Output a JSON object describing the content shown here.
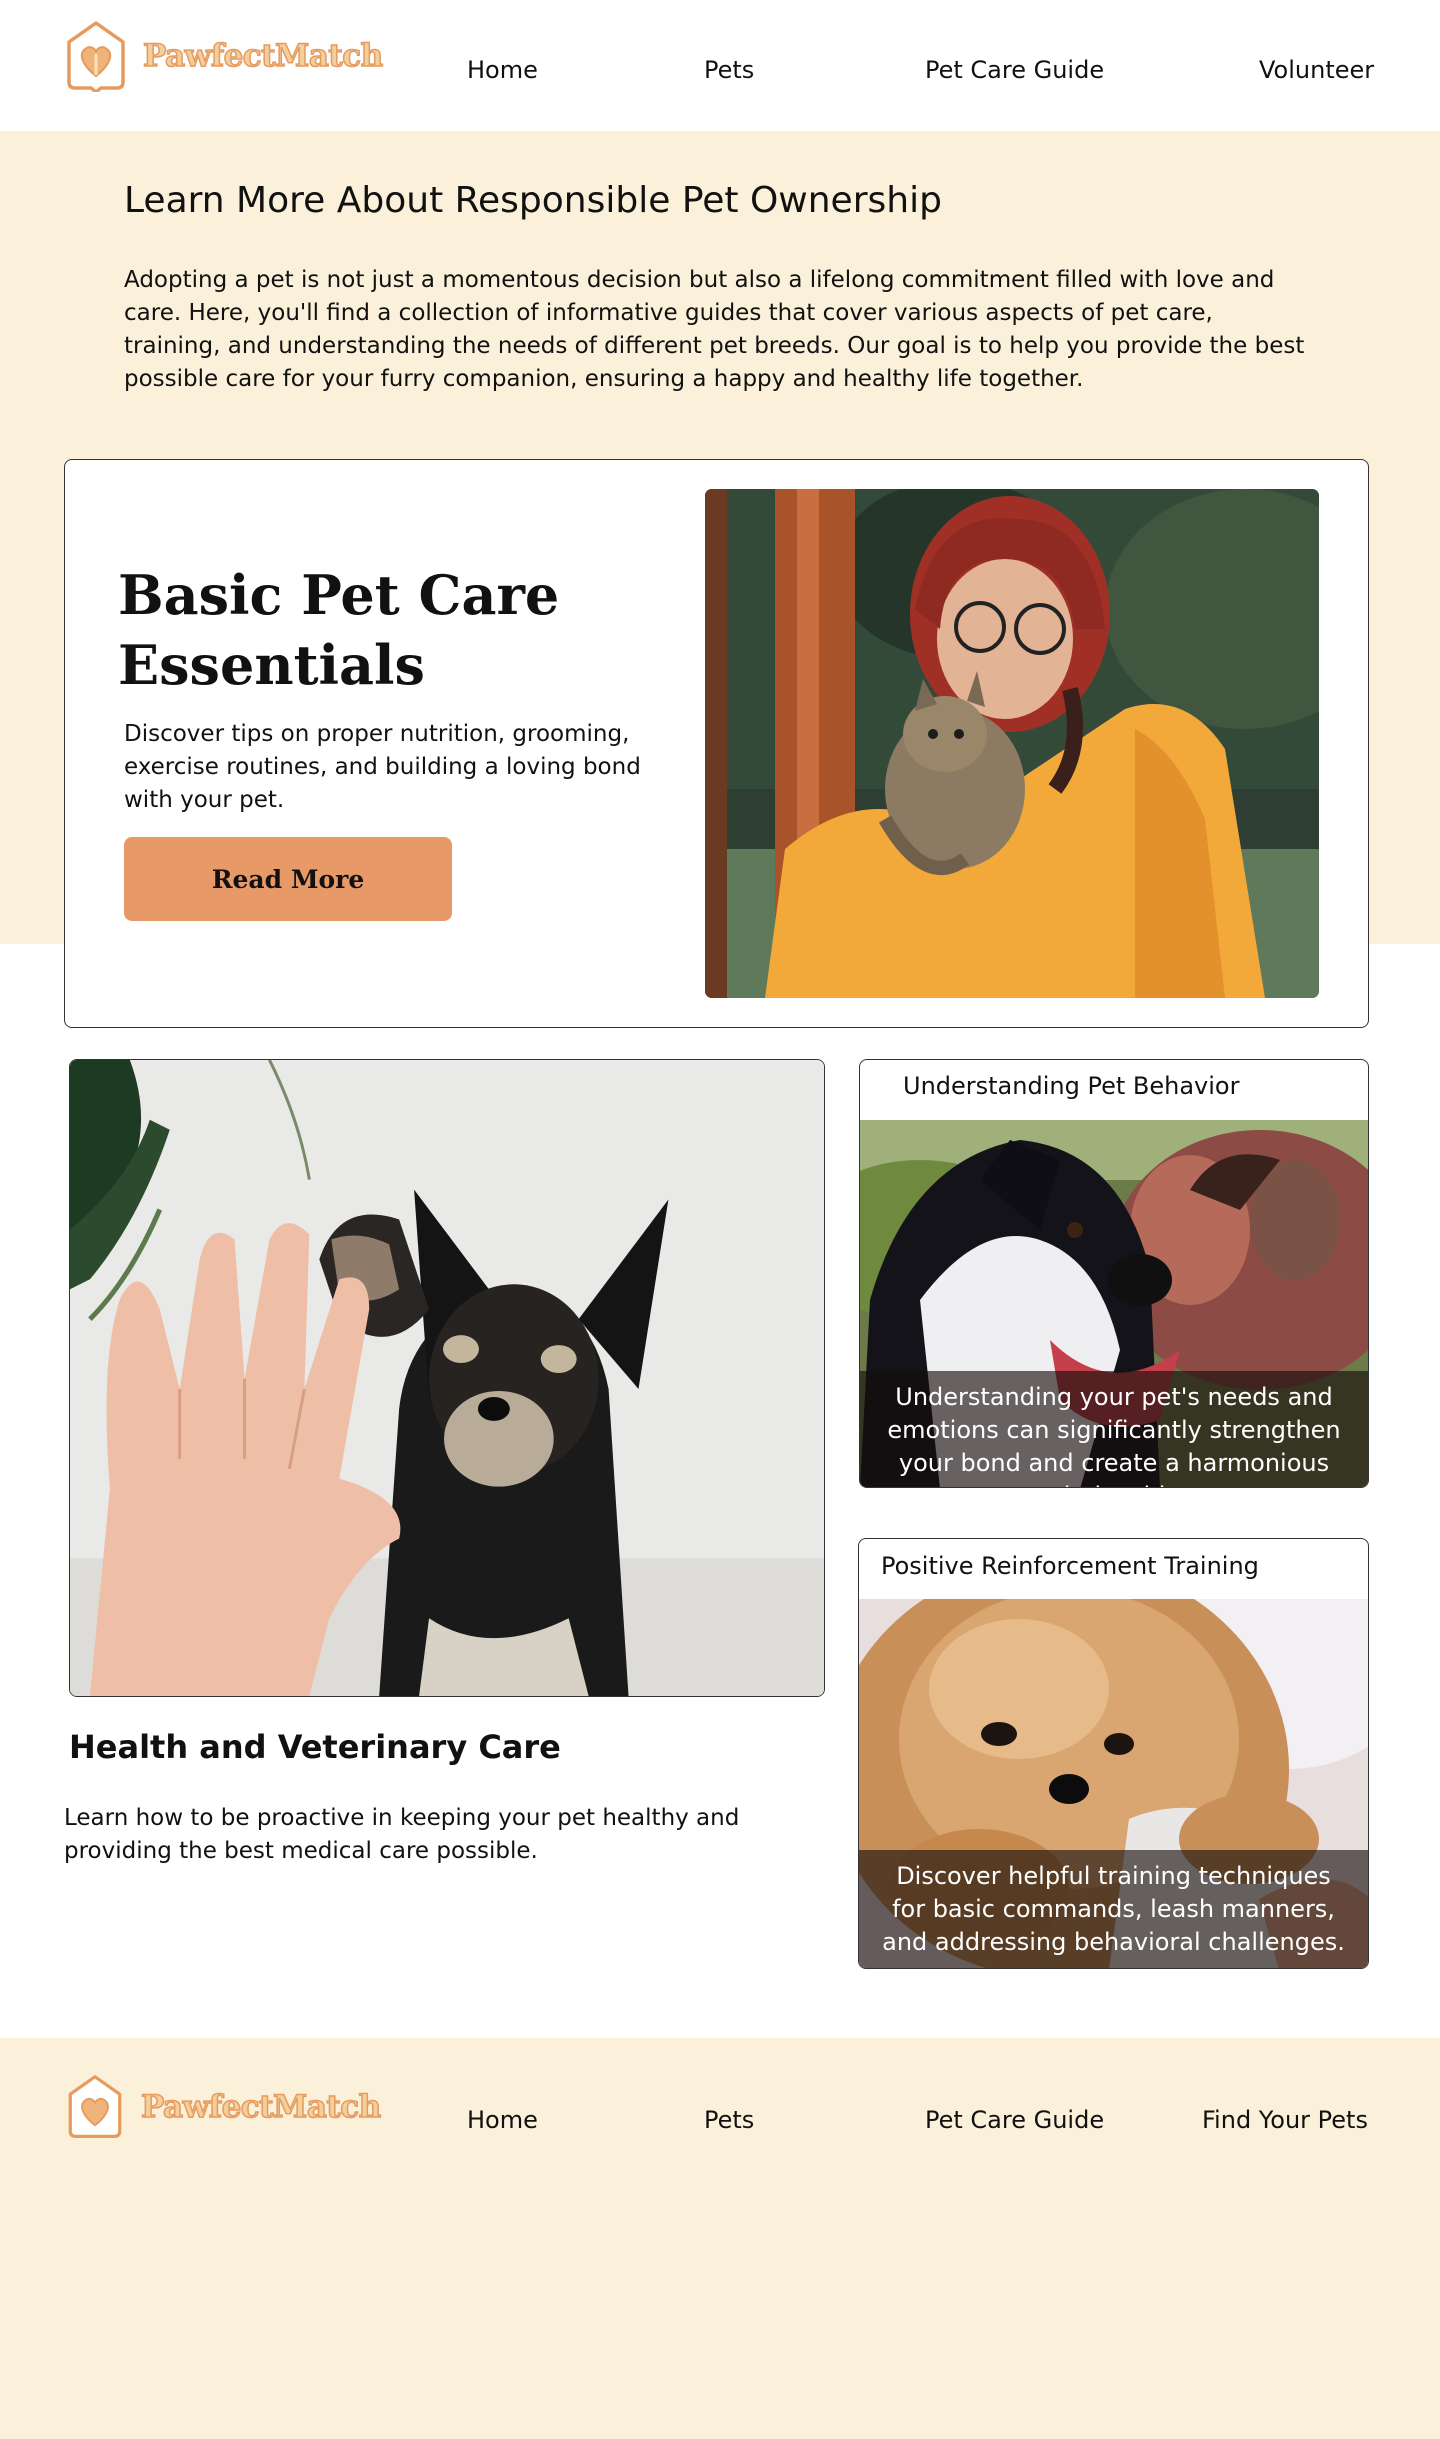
{
  "brand": {
    "name": "PawfectMatch",
    "colors": {
      "accent": "#e79a68",
      "cream": "#fbf0d9",
      "logo_fill": "#f3cf9c",
      "logo_stroke": "#e69a5e"
    }
  },
  "header": {
    "logo_icon": "house-heart-icon",
    "nav": [
      "Home",
      "Pets",
      "Pet Care Guide",
      "Volunteer"
    ]
  },
  "intro": {
    "title": "Learn More About Responsible Pet Ownership",
    "text": "Adopting a pet is not just a momentous decision but also a lifelong commitment filled with love and care. Here, you'll find a collection of informative guides that cover various aspects of pet care, training, and understanding the needs of different pet breeds. Our goal is to help you provide the best possible care for your furry companion, ensuring a happy and healthy life together."
  },
  "basic_care": {
    "title": "Basic Pet Care Essentials",
    "text": "Discover tips on proper nutrition, grooming, exercise routines, and building a loving bond with your pet.",
    "button": "Read More"
  },
  "health": {
    "title": "Health and Veterinary Care",
    "text": "Learn how to be proactive in keeping your pet healthy and providing the best medical care possible."
  },
  "behavior": {
    "title": "Understanding Pet Behavior",
    "text": "Understanding your pet's needs and emotions can significantly strengthen your bond and create a harmonious relationship."
  },
  "training": {
    "title": "Positive Reinforcement Training",
    "text": "Discover helpful training techniques for basic commands, leash manners, and addressing behavioral challenges."
  },
  "footer": {
    "nav": [
      "Home",
      "Pets",
      "Pet Care Guide",
      "Find Your Pets"
    ]
  }
}
